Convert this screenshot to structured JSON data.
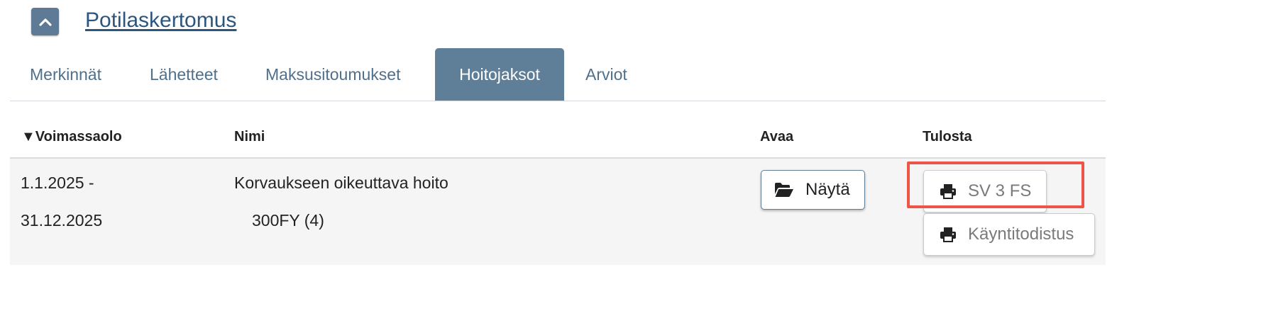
{
  "header": {
    "collapse_icon": "chevron-up-icon",
    "title": "Potilaskertomus"
  },
  "tabs": [
    {
      "label": "Merkinnät",
      "active": false
    },
    {
      "label": "Lähetteet",
      "active": false
    },
    {
      "label": "Maksusitoumukset",
      "active": false
    },
    {
      "label": "Hoitojaksot",
      "active": true
    },
    {
      "label": "Arviot",
      "active": false
    }
  ],
  "table": {
    "columns": {
      "validity": "▼Voimassaolo",
      "name": "Nimi",
      "open": "Avaa",
      "print": "Tulosta"
    },
    "rows": [
      {
        "validity_start": "1.1.2025 -",
        "validity_end": "31.12.2025",
        "name": "Korvaukseen oikeuttava hoito",
        "code": "300FY (4)",
        "open_label": "Näytä",
        "open_icon": "folder-open-icon",
        "print_buttons": [
          {
            "label": "SV 3 FS",
            "icon": "printer-icon",
            "highlighted": true
          },
          {
            "label": "Käyntitodistus",
            "icon": "printer-icon",
            "highlighted": false
          }
        ]
      }
    ]
  },
  "colors": {
    "accent": "#5f7e98",
    "link": "#2c567e",
    "tab_text": "#4f6f8b",
    "highlight": "#ee5548",
    "row_bg": "#f5f5f5"
  }
}
